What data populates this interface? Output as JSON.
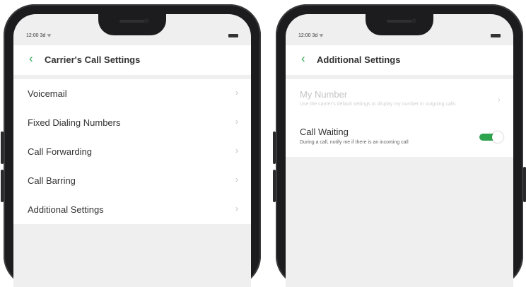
{
  "left_phone": {
    "status_time": "12:00 3d ᯤ",
    "title": "Carrier's Call Settings",
    "items": [
      {
        "label": "Voicemail"
      },
      {
        "label": "Fixed Dialing Numbers"
      },
      {
        "label": "Call Forwarding"
      },
      {
        "label": "Call Barring"
      },
      {
        "label": "Additional Settings"
      }
    ]
  },
  "right_phone": {
    "status_time": "12:00 3d ᯤ",
    "title": "Additional Settings",
    "my_number": {
      "label": "My Number",
      "description": "Use the carrier's default settings to display my number in outgoing calls",
      "enabled": false
    },
    "call_waiting": {
      "label": "Call Waiting",
      "description": "During a call, notify me if there is an incoming call",
      "toggle_on": true
    }
  },
  "colors": {
    "accent": "#2ea44f",
    "background": "#efefef",
    "text": "#333333"
  },
  "icons": {
    "back": "chevron-left-icon",
    "row_arrow": "chevron-right-icon",
    "toggle": "toggle-switch"
  }
}
